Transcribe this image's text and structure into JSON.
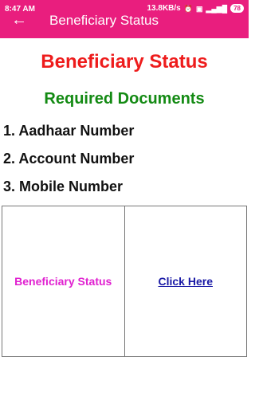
{
  "status_bar": {
    "time": "8:47 AM",
    "network_speed": "13.8KB/s",
    "battery": "78",
    "icons": [
      "alarm-off-icon",
      "volte-icon",
      "signal-4g-icon",
      "battery-icon"
    ]
  },
  "app_bar": {
    "back_icon": "arrow-left-icon",
    "title": "Beneficiary Status"
  },
  "main": {
    "title": "Beneficiary Status",
    "section_title": "Required Documents",
    "documents": [
      "1. Aadhaar Number",
      "2. Account Number",
      "3. Mobile Number"
    ],
    "table": {
      "left_label": "Beneficiary Status",
      "right_link": "Click Here"
    }
  },
  "colors": {
    "primary": "#e91e7e",
    "title_red": "#ee1c1c",
    "section_green": "#138a13",
    "label_magenta": "#e020d0",
    "link_blue": "#1a1aa6"
  }
}
